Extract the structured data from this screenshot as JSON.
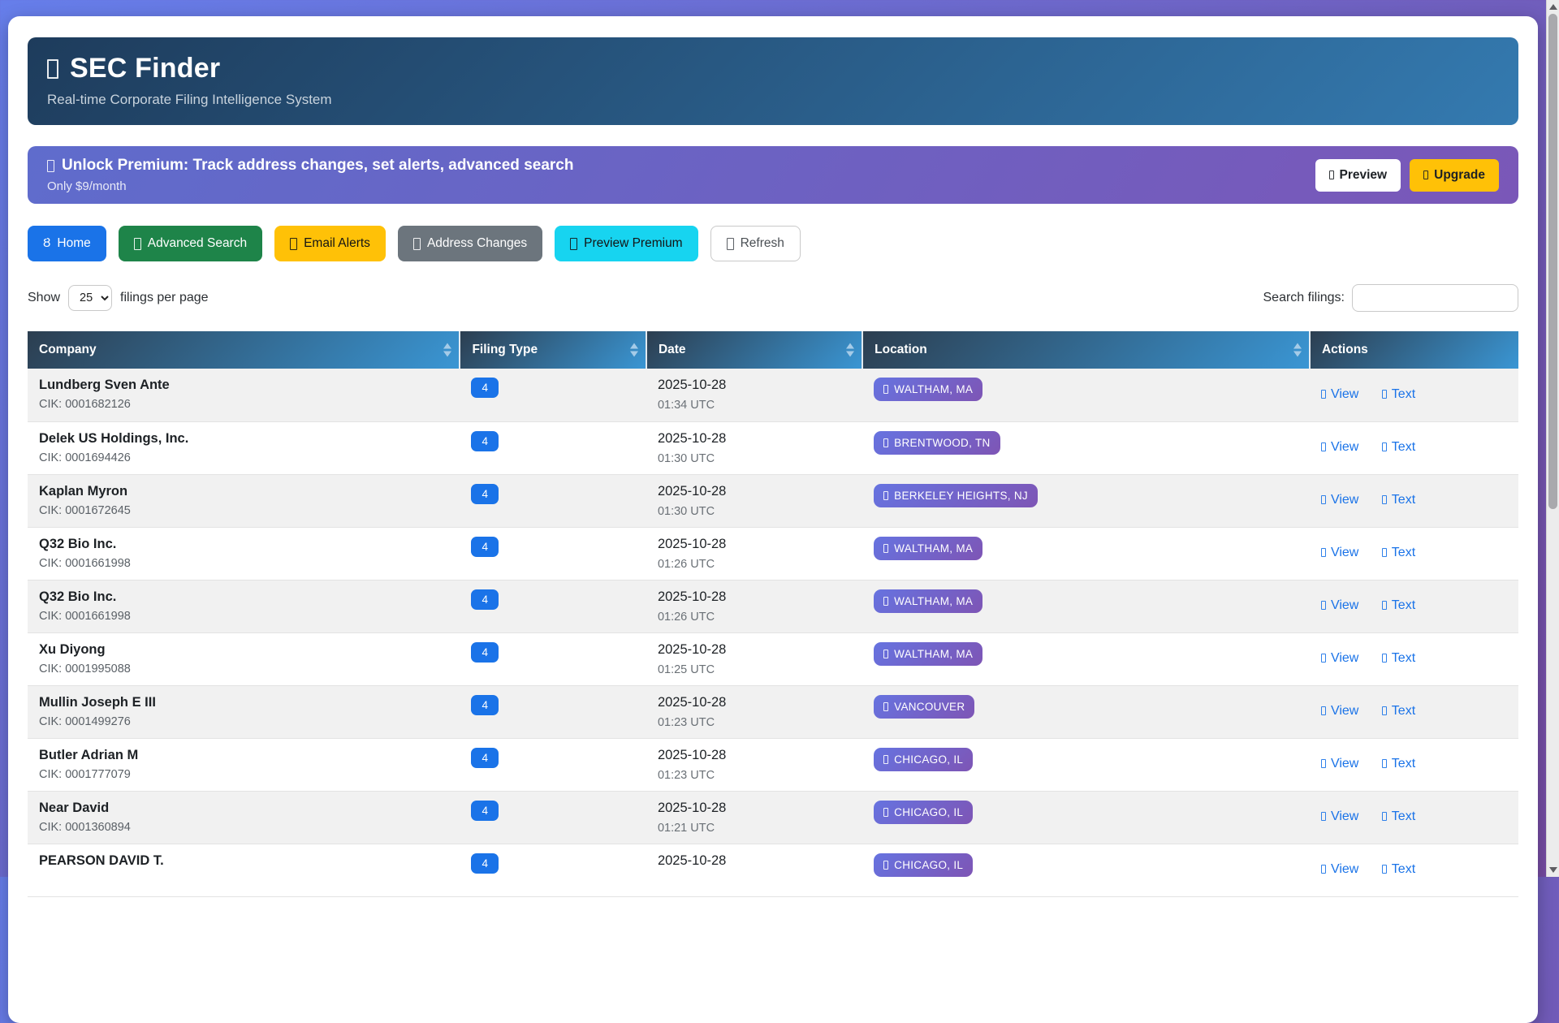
{
  "page": {
    "background_gradient": [
      "#667eea",
      "#764ba2"
    ],
    "accent_blue": "#1a73e8",
    "header_gradient": [
      "#1e3c5c",
      "#347ab0"
    ],
    "table_header_gradient": [
      "#2c3e50",
      "#3a96d4"
    ],
    "location_badge_gradient": [
      "#6673e0",
      "#7e55b5"
    ]
  },
  "header": {
    "icon": "app-logo-icon (unrendered emoji tofu)",
    "title": "SEC Finder",
    "subtitle": "Real-time Corporate Filing Intelligence System"
  },
  "premium_banner": {
    "icon": "lock-icon (unrendered emoji tofu)",
    "title": "Unlock Premium: Track address changes, set alerts, advanced search",
    "subtitle": "Only $9/month",
    "preview_label": "Preview",
    "upgrade_label": "Upgrade",
    "upgrade_color": "#ffc107"
  },
  "nav": {
    "buttons": [
      {
        "label": "Home",
        "icon": "home-icon",
        "glyph": "Ȣ",
        "color": "#1a73e8",
        "text_color": "#ffffff"
      },
      {
        "label": "Advanced Search",
        "icon": "search-icon",
        "glyph": "tofu",
        "color": "#1e8449",
        "text_color": "#ffffff"
      },
      {
        "label": "Email Alerts",
        "icon": "email-icon",
        "glyph": "tofu",
        "color": "#ffc107",
        "text_color": "#141414"
      },
      {
        "label": "Address Changes",
        "icon": "address-icon",
        "glyph": "tofu",
        "color": "#6c757d",
        "text_color": "#ffffff"
      },
      {
        "label": "Preview Premium",
        "icon": "premium-star-icon",
        "glyph": "tofu",
        "color": "#17d4f0",
        "text_color": "#141414"
      },
      {
        "label": "Refresh",
        "icon": "refresh-icon",
        "glyph": "tofu",
        "color": "#ffffff",
        "text_color": "#4a4f54",
        "border": "#c9c9c9"
      }
    ]
  },
  "controls": {
    "show_label": "Show",
    "per_page_value": "25",
    "per_page_suffix": "filings per page",
    "search_label": "Search filings:",
    "search_value": ""
  },
  "table": {
    "columns": [
      {
        "label": "Company",
        "sortable": true
      },
      {
        "label": "Filing Type",
        "sortable": true
      },
      {
        "label": "Date",
        "sortable": true
      },
      {
        "label": "Location",
        "sortable": true
      },
      {
        "label": "Actions",
        "sortable": false
      }
    ],
    "actions": {
      "view_label": "View",
      "text_label": "Text",
      "view_icon": "document-view-icon",
      "text_icon": "text-file-icon"
    },
    "location_pin_icon": "map-pin-icon (unrendered emoji tofu)",
    "rows": [
      {
        "company": "Lundberg Sven Ante",
        "cik": "CIK: 0001682126",
        "filing_type": "4",
        "date": "2025-10-28",
        "time": "01:34 UTC",
        "location": "WALTHAM, MA"
      },
      {
        "company": "Delek US Holdings, Inc.",
        "cik": "CIK: 0001694426",
        "filing_type": "4",
        "date": "2025-10-28",
        "time": "01:30 UTC",
        "location": "BRENTWOOD, TN"
      },
      {
        "company": "Kaplan Myron",
        "cik": "CIK: 0001672645",
        "filing_type": "4",
        "date": "2025-10-28",
        "time": "01:30 UTC",
        "location": "BERKELEY HEIGHTS, NJ"
      },
      {
        "company": "Q32 Bio Inc.",
        "cik": "CIK: 0001661998",
        "filing_type": "4",
        "date": "2025-10-28",
        "time": "01:26 UTC",
        "location": "WALTHAM, MA"
      },
      {
        "company": "Q32 Bio Inc.",
        "cik": "CIK: 0001661998",
        "filing_type": "4",
        "date": "2025-10-28",
        "time": "01:26 UTC",
        "location": "WALTHAM, MA"
      },
      {
        "company": "Xu Diyong",
        "cik": "CIK: 0001995088",
        "filing_type": "4",
        "date": "2025-10-28",
        "time": "01:25 UTC",
        "location": "WALTHAM, MA"
      },
      {
        "company": "Mullin Joseph E III",
        "cik": "CIK: 0001499276",
        "filing_type": "4",
        "date": "2025-10-28",
        "time": "01:23 UTC",
        "location": "VANCOUVER"
      },
      {
        "company": "Butler Adrian M",
        "cik": "CIK: 0001777079",
        "filing_type": "4",
        "date": "2025-10-28",
        "time": "01:23 UTC",
        "location": "CHICAGO, IL"
      },
      {
        "company": "Near David",
        "cik": "CIK: 0001360894",
        "filing_type": "4",
        "date": "2025-10-28",
        "time": "01:21 UTC",
        "location": "CHICAGO, IL"
      },
      {
        "company": "PEARSON DAVID T.",
        "cik": "",
        "filing_type": "4",
        "date": "2025-10-28",
        "time": "",
        "location": "CHICAGO, IL"
      }
    ]
  }
}
